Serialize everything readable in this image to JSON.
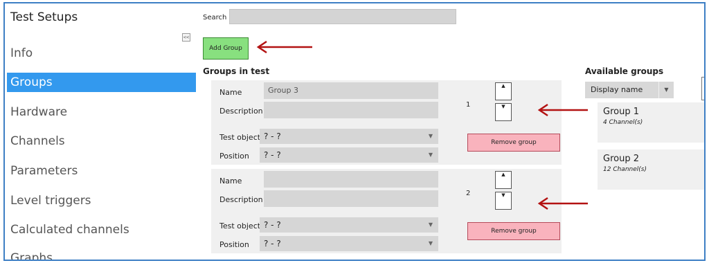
{
  "sidebar": {
    "title": "Test Setups",
    "collapse_label": "<<",
    "items": [
      {
        "label": "Info"
      },
      {
        "label": "Groups"
      },
      {
        "label": "Hardware"
      },
      {
        "label": "Channels"
      },
      {
        "label": "Parameters"
      },
      {
        "label": "Level triggers"
      },
      {
        "label": "Calculated channels"
      },
      {
        "label": "Graphs"
      }
    ],
    "active_index": 1
  },
  "search": {
    "label": "Search",
    "value": ""
  },
  "add_group_label": "Add Group",
  "groups_in_test": {
    "title": "Groups in test",
    "labels": {
      "name": "Name",
      "description": "Description",
      "test_object": "Test object",
      "position": "Position"
    },
    "remove_label": "Remove group",
    "up_icon": "▲",
    "down_icon": "▼",
    "select_arrow_icon": "▼",
    "groups": [
      {
        "order": "1",
        "name": "Group 3",
        "description": "",
        "test_object": "? - ?",
        "position": "? - ?"
      },
      {
        "order": "2",
        "name": "",
        "description": "",
        "test_object": "? - ?",
        "position": "? - ?"
      }
    ]
  },
  "available_groups": {
    "title": "Available groups",
    "sort_label": "Display name",
    "items": [
      {
        "name": "Group 1",
        "sub": "4 Channel(s)"
      },
      {
        "name": "Group 2",
        "sub": "12 Channel(s)"
      }
    ]
  },
  "colors": {
    "frame_border": "#3d7ec4",
    "active_nav": "#3399ee",
    "add_button": "#88e07f",
    "remove_button": "#f9b3bd",
    "annotation_arrow": "#b31212"
  }
}
